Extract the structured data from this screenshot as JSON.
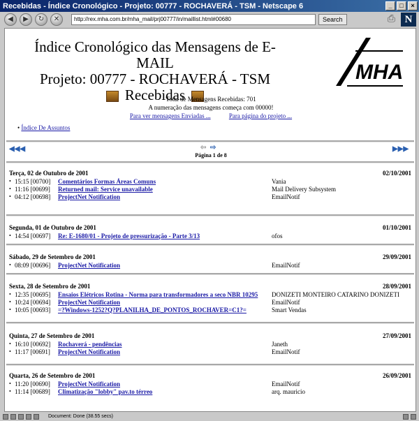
{
  "window": {
    "title": "Recebidas - Índice Cronológico - Projeto: 00777 - ROCHAVERÁ - TSM - Netscape 6"
  },
  "toolbar": {
    "url": "http://rex.mha.com.br/mha_mail/prj00777/in/maillist.html#00680",
    "search_label": "Search"
  },
  "header": {
    "line1": "Índice Cronológico das Mensagens de E-MAIL",
    "line2": "Projeto: 00777 - ROCHAVERÁ - TSM",
    "line3": "Recebidas",
    "logo_text": "MHA"
  },
  "summary": {
    "total": "Total de Mensagens Recebidas: 701",
    "numbering": "A numeração das mensagens começa com 00000!",
    "link_sent": "Para ver mensagens Enviadas ...",
    "link_project": "Para página do projeto ..."
  },
  "subjects_link": "Índice De Assuntos",
  "pager": {
    "info": "Página 1 de 8"
  },
  "days": [
    {
      "label": "Terça, 02 de Outubro de 2001",
      "date": "02/10/2001",
      "messages": [
        {
          "time": "15:15 [00700]",
          "subject": "Comentários Formas Áreas Comuns",
          "from": "Vania"
        },
        {
          "time": "11:16 [00699]",
          "subject": "Returned mail: Service unavailable",
          "from": "Mail Delivery Subsystem"
        },
        {
          "time": "04:12 [00698]",
          "subject": "ProjectNet Notification",
          "from": "EmailNotif"
        }
      ]
    },
    {
      "label": "Segunda, 01 de Outubro de 2001",
      "date": "01/10/2001",
      "messages": [
        {
          "time": "14:54 [00697]",
          "subject": "Re: E-1680/01 - Projeto de pressurização - Parte 3/13",
          "from": "ofos"
        }
      ]
    },
    {
      "label": "Sábado, 29 de Setembro de 2001",
      "date": "29/09/2001",
      "messages": [
        {
          "time": "08:09 [00696]",
          "subject": "ProjectNet Notification",
          "from": "EmailNotif"
        }
      ]
    },
    {
      "label": "Sexta, 28 de Setembro de 2001",
      "date": "28/09/2001",
      "messages": [
        {
          "time": "12:35 [00695]",
          "subject": "Ensaios Elétricos Rotina - Norma para transformadores a seco NBR 10295",
          "from": "DONIZETI MONTEIRO CATARINO DONIZETI"
        },
        {
          "time": "10:24 [00694]",
          "subject": "ProjectNet Notification",
          "from": "EmailNotif"
        },
        {
          "time": "10:05 [00693]",
          "subject": "=?Windows-1252?Q?PLANILHA_DE_PONTOS_ROCHAVER=C1?=",
          "from": "Smart Vendas"
        }
      ]
    },
    {
      "label": "Quinta, 27 de Setembro de 2001",
      "date": "27/09/2001",
      "messages": [
        {
          "time": "16:10 [00692]",
          "subject": "Rochaverá - pendências",
          "from": "Janeth"
        },
        {
          "time": "11:17 [00691]",
          "subject": "ProjectNet Notification",
          "from": "EmailNotif"
        }
      ]
    },
    {
      "label": "Quarta, 26 de Setembro de 2001",
      "date": "26/09/2001",
      "messages": [
        {
          "time": "11:20 [00690]",
          "subject": "ProjectNet Notification",
          "from": "EmailNotif"
        },
        {
          "time": "11:14 [00689]",
          "subject": "Climatização \"lobby\" pav.to térreo",
          "from": "arq. mauricio"
        }
      ]
    }
  ],
  "status": {
    "text": "Document: Done (38.55 secs)"
  }
}
